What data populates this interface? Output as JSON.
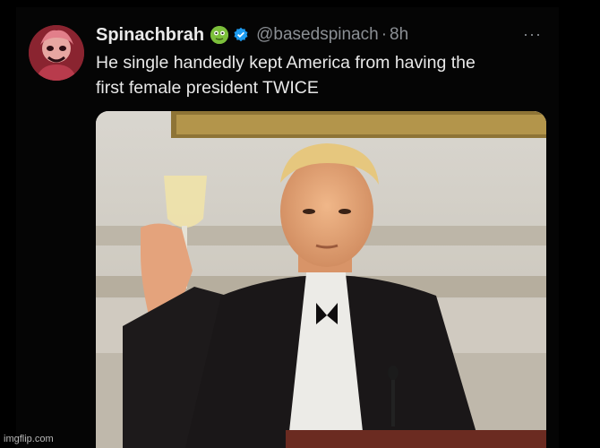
{
  "tweet": {
    "display_name": "Spinachbrah",
    "handle": "@basedspinach",
    "separator": "·",
    "time": "8h",
    "more_label": "···",
    "text_line_1": "He single handedly kept America from having the",
    "text_line_2": "first female president TWICE"
  },
  "icons": {
    "badge": "green-face-emoji-icon",
    "verified": "verified-badge-icon",
    "more": "more-options-icon"
  },
  "colors": {
    "background": "#000000",
    "text": "#e8e8e8",
    "muted": "#8b8f94",
    "verified": "#1d9bf0"
  },
  "watermark": "imgflip.com"
}
